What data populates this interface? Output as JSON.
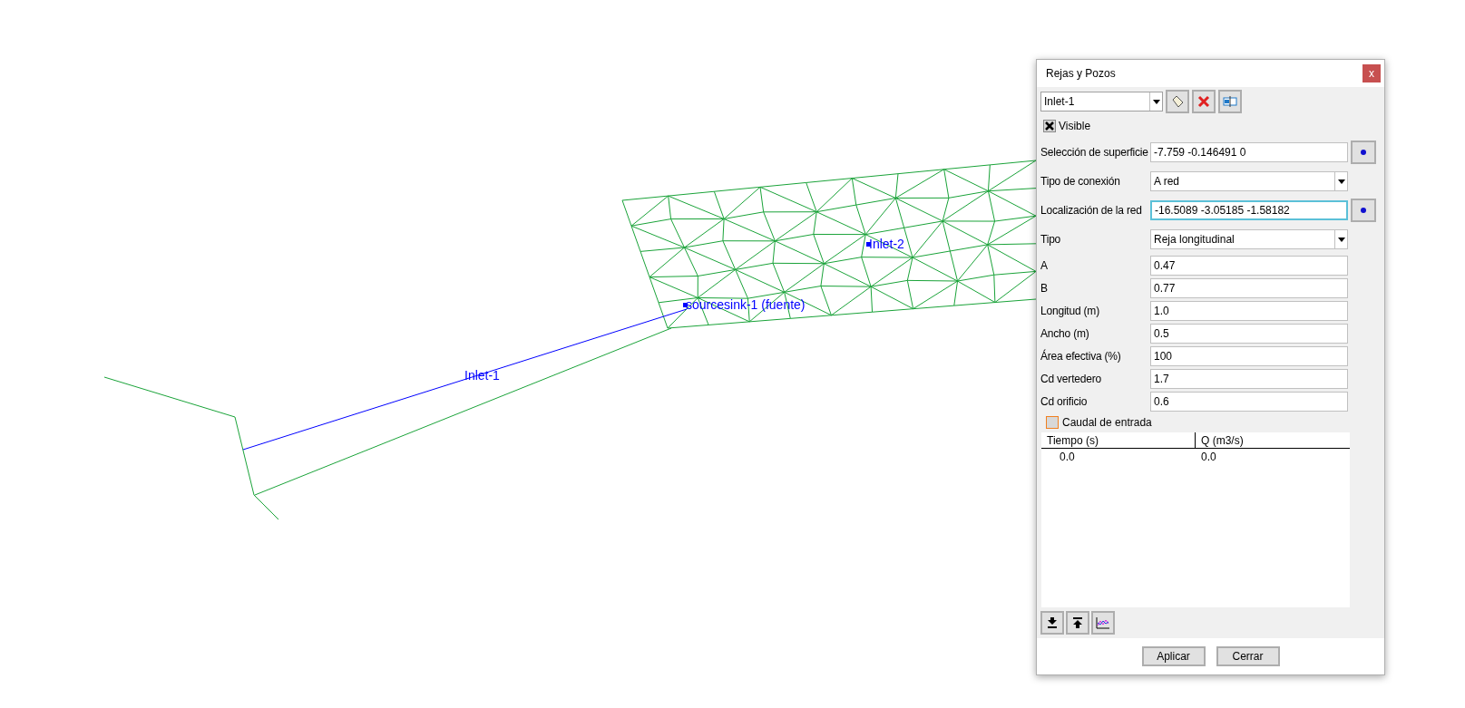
{
  "canvas": {
    "labels": [
      {
        "text": "Inlet-1",
        "kind": "line"
      },
      {
        "text": "sourcesink-1 (fuente)",
        "kind": "point"
      },
      {
        "text": "Inlet-2",
        "kind": "point"
      }
    ]
  },
  "dialog": {
    "title": "Rejas y Pozos",
    "close": "x",
    "selector": {
      "value": "Inlet-1"
    },
    "visible": {
      "label": "Visible",
      "checked": true
    },
    "fields": [
      {
        "label": "Selección de superficie",
        "kind": "text",
        "value": "-7.759 -0.146491 0",
        "pick_button": true,
        "focused": false
      },
      {
        "label": "Tipo de conexión",
        "kind": "dropdown",
        "value": "A red",
        "pick_button": false,
        "focused": false
      },
      {
        "label": "Localización de la red",
        "kind": "text",
        "value": "-16.5089 -3.05185 -1.58182",
        "pick_button": true,
        "focused": true
      },
      {
        "label": "Tipo",
        "kind": "dropdown",
        "value": "Reja longitudinal",
        "pick_button": false,
        "focused": false
      },
      {
        "label": "A",
        "kind": "text",
        "value": "0.47",
        "pick_button": false,
        "focused": false
      },
      {
        "label": "B",
        "kind": "text",
        "value": "0.77",
        "pick_button": false,
        "focused": false
      },
      {
        "label": "Longitud (m)",
        "kind": "text",
        "value": "1.0",
        "pick_button": false,
        "focused": false
      },
      {
        "label": "Ancho (m)",
        "kind": "text",
        "value": "0.5",
        "pick_button": false,
        "focused": false
      },
      {
        "label": "Área efectiva (%)",
        "kind": "text",
        "value": "100",
        "pick_button": false,
        "focused": false
      },
      {
        "label": "Cd vertedero",
        "kind": "text",
        "value": "1.7",
        "pick_button": false,
        "focused": false
      },
      {
        "label": "Cd orificio",
        "kind": "text",
        "value": "0.6",
        "pick_button": false,
        "focused": false
      }
    ],
    "inflow": {
      "label": "Caudal de entrada",
      "checked": false
    },
    "table": {
      "columns": [
        "Tiempo (s)",
        "Q (m3/s)"
      ],
      "rows": [
        [
          "0.0",
          "0.0"
        ]
      ]
    },
    "buttons": [
      "Aplicar",
      "Cerrar"
    ]
  }
}
